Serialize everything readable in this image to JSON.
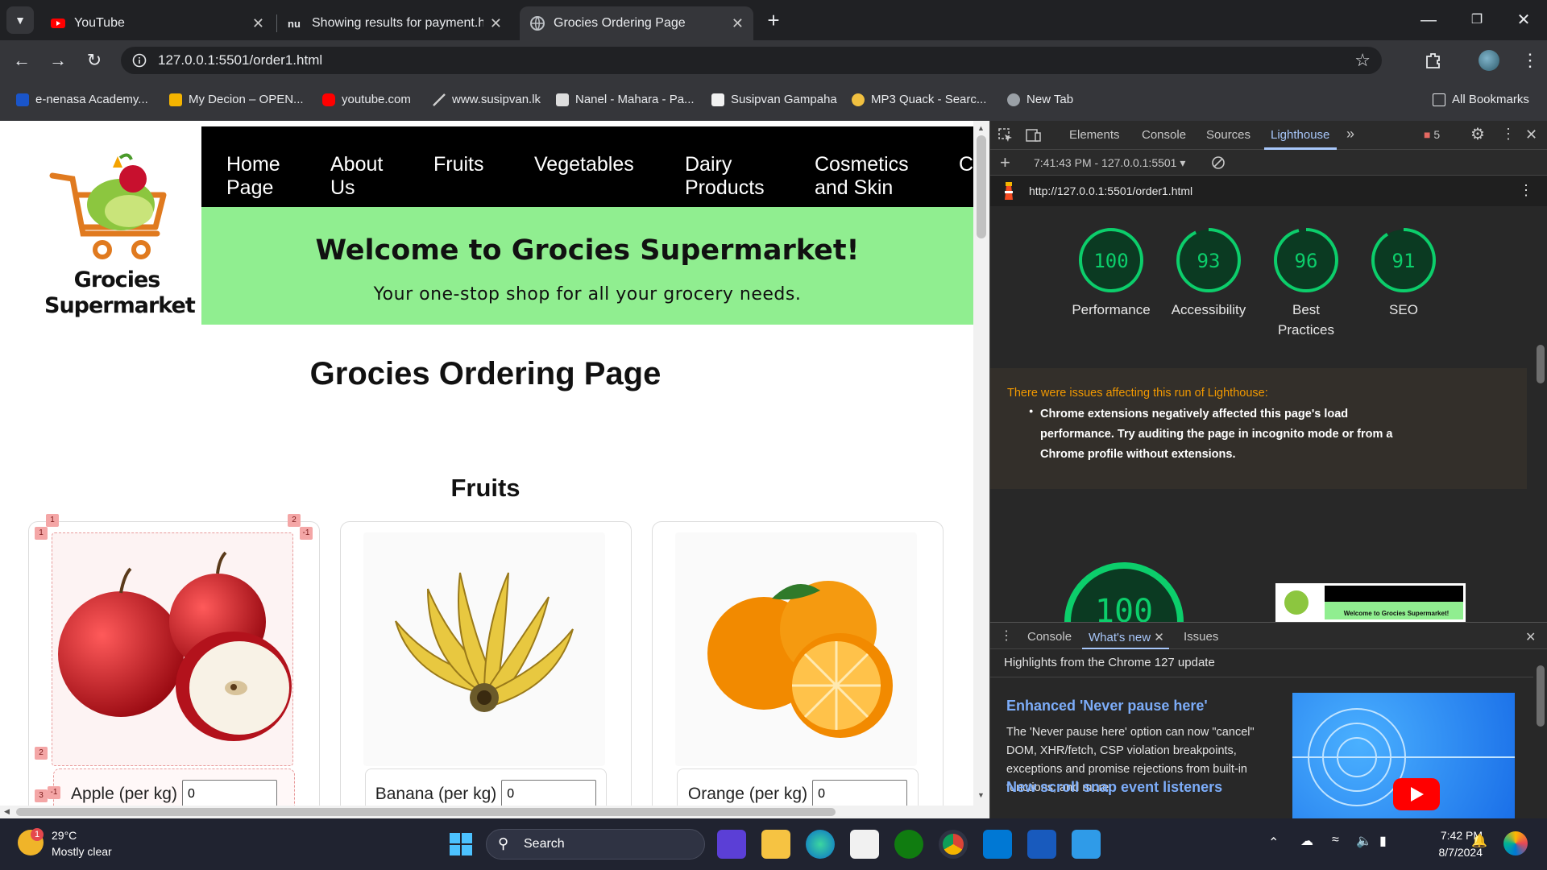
{
  "browser": {
    "tabs": [
      {
        "title": "YouTube",
        "icon": "youtube-icon",
        "active": false
      },
      {
        "title": "Showing results for payment.ht",
        "icon": "nu-icon",
        "active": false
      },
      {
        "title": "Grocies Ordering Page",
        "icon": "globe-icon",
        "active": true
      }
    ],
    "new_tab_label": "+",
    "url": "127.0.0.1:5501/order1.html",
    "bookmarks": [
      {
        "label": "e-nenasa Academy...",
        "icon": "enenasa-icon"
      },
      {
        "label": "My Decion – OPEN...",
        "icon": "decion-icon"
      },
      {
        "label": "youtube.com",
        "icon": "youtube-icon"
      },
      {
        "label": "www.susipvan.lk",
        "icon": "susipvan-icon"
      },
      {
        "label": "Nanel - Mahara - Pa...",
        "icon": "nanel-icon"
      },
      {
        "label": "Susipvan Gampaha",
        "icon": "page-icon"
      },
      {
        "label": "MP3 Quack - Searc...",
        "icon": "duck-icon"
      },
      {
        "label": "New Tab",
        "icon": "globe-icon"
      }
    ],
    "all_bookmarks_label": "All Bookmarks"
  },
  "page": {
    "logo": {
      "line1": "Grocies",
      "line2": "Supermarket"
    },
    "nav": [
      {
        "line1": "Home",
        "line2": "Page"
      },
      {
        "line1": "About",
        "line2": "Us"
      },
      {
        "line1": "Fruits",
        "line2": ""
      },
      {
        "line1": "Vegetables",
        "line2": ""
      },
      {
        "line1": "Dairy",
        "line2": "Products"
      },
      {
        "line1": "Cosmetics",
        "line2": "and Skin"
      },
      {
        "line1": "C",
        "line2": ""
      }
    ],
    "welcome_title": "Welcome to Grocies Supermarket!",
    "welcome_subtitle": "Your one-stop shop for all your grocery needs.",
    "page_title": "Grocies Ordering Page",
    "section_title": "Fruits",
    "products": [
      {
        "label": "Apple (per kg)",
        "qty": "0"
      },
      {
        "label": "Banana (per kg)",
        "qty": "0"
      },
      {
        "label": "Orange (per kg)",
        "qty": "0"
      }
    ],
    "grid_markers": [
      "1",
      "2",
      "1",
      "-1",
      "2",
      "3",
      "-1"
    ]
  },
  "devtools": {
    "tabs": [
      "Elements",
      "Console",
      "Sources",
      "Lighthouse"
    ],
    "active_tab": "Lighthouse",
    "error_count": "5",
    "report_time": "7:41:43 PM - 127.0.0.1:5501",
    "report_url": "http://127.0.0.1:5501/order1.html",
    "scores": [
      {
        "value": 100,
        "label": "Performance"
      },
      {
        "value": 93,
        "label": "Accessibility"
      },
      {
        "value": 96,
        "label": "Best Practices"
      },
      {
        "value": 91,
        "label": "SEO"
      }
    ],
    "issues_heading": "There were issues affecting this run of Lighthouse:",
    "issues_text": "Chrome extensions negatively affected this page's load performance. Try auditing the page in incognito mode or from a Chrome profile without extensions.",
    "big_score": "100",
    "thumb_welcome": "Welcome to Grocies Supermarket!",
    "drawer_tabs": [
      "Console",
      "What's new",
      "Issues"
    ],
    "drawer_active": "What's new",
    "drawer_heading": "Highlights from the Chrome 127 update",
    "news_title": "Enhanced 'Never pause here'",
    "news_body": "The 'Never pause here' option can now \"cancel\" DOM, XHR/fetch, CSP violation breakpoints, exceptions and promise rejections from built-in functions, and more.",
    "news_title2": "New scroll snap event listeners"
  },
  "taskbar": {
    "weather_temp": "29°C",
    "weather_desc": "Mostly clear",
    "weather_badge": "1",
    "search_label": "Search",
    "time": "7:42 PM",
    "date": "8/7/2024"
  },
  "colors": {
    "accent_green": "#90ee90",
    "score_green": "#0cce6b",
    "issue_orange": "#f29900",
    "link_blue": "#7cacf8"
  }
}
